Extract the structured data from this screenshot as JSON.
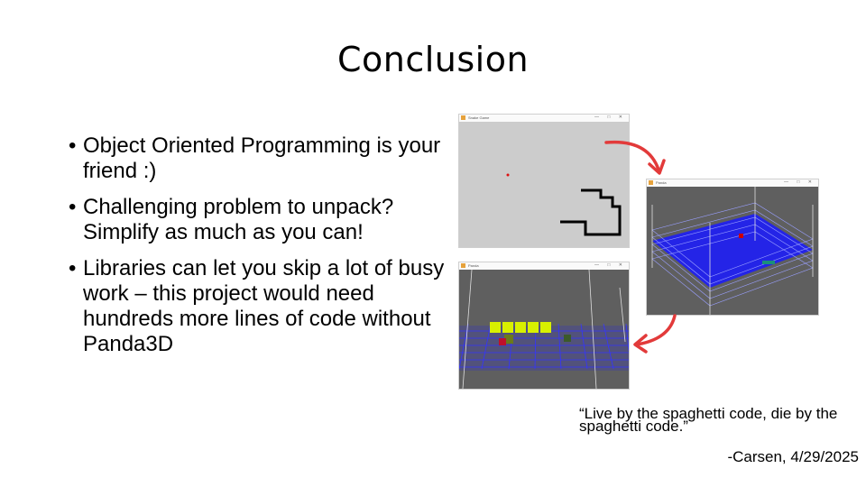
{
  "slide": {
    "title": "Conclusion",
    "bullets": [
      "Object Oriented Programming is your friend :)",
      "Challenging problem to unpack? Simplify as much as you can!",
      "Libraries can let you skip a lot of busy work – this project would need hundreds more lines of code without Panda3D"
    ],
    "quote": "“Live by the spaghetti code, die by the spaghetti code.”",
    "quote_author": "-Carsen, 4/29/2025"
  },
  "screenshots": {
    "snake_2d": {
      "window_title": "Snake Game"
    },
    "snake_3d_grid": {
      "window_title": "Panda"
    },
    "snake_3d_cubes": {
      "window_title": "Panda"
    },
    "window_controls": "— □ ✕"
  },
  "colors": {
    "arrow": "#e23a3a",
    "grid_blue": "#1a1aff",
    "viewport_gray": "#5f5f5f",
    "snake_2d_bg": "#cccccc",
    "cube_yellow": "#d8f000"
  }
}
